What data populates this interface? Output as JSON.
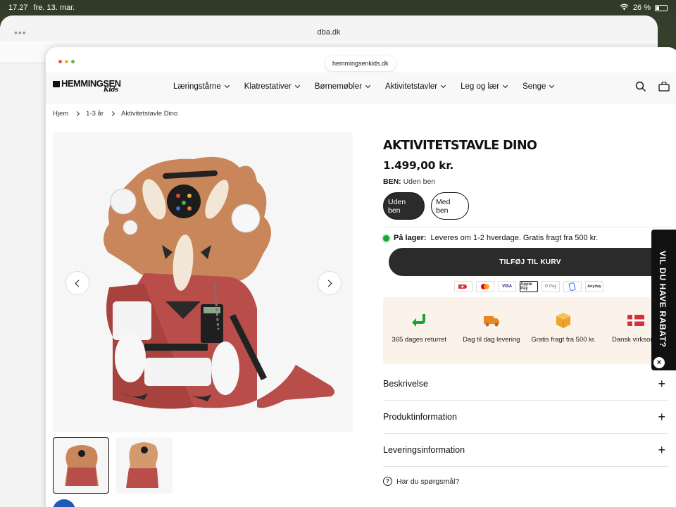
{
  "status": {
    "time": "17.27",
    "date": "fre. 13. mar.",
    "battery": "26 %"
  },
  "background_window": {
    "url": "dba.dk"
  },
  "browser": {
    "url": "hemmingsenkids.dk"
  },
  "logo": {
    "brand": "HEMMINGSEN",
    "sub": "Kids"
  },
  "nav": {
    "items": [
      {
        "label": "Læringstårne"
      },
      {
        "label": "Klatrestativer"
      },
      {
        "label": "Børnemøbler"
      },
      {
        "label": "Aktivitetstavler"
      },
      {
        "label": "Leg og lær"
      },
      {
        "label": "Senge"
      }
    ]
  },
  "breadcrumb": {
    "items": [
      "Hjem",
      "1-3 år",
      "Aktivitetstavle Dino"
    ]
  },
  "product": {
    "title": "AKTIVITETSTAVLE DINO",
    "price": "1.499,00 kr.",
    "variant_label": "BEN:",
    "variant_value": "Uden ben",
    "options": [
      {
        "label": "Uden ben",
        "selected": true
      },
      {
        "label": "Med ben",
        "selected": false
      }
    ],
    "stock_label": "På lager:",
    "stock_text": "Leveres om 1-2 hverdage. Gratis fragt fra 500 kr.",
    "add_to_cart": "TILFØJ TIL KURV"
  },
  "payments": [
    "Dankort",
    "Mastercard",
    "VISA",
    "Apple Pay",
    "G Pay",
    "MobilePay",
    "Anyday"
  ],
  "payment_icons": [
    "dankort-icon",
    "mastercard-icon",
    "visa-icon",
    "apple-pay-icon",
    "google-pay-icon",
    "mobilepay-icon",
    "anyday-icon"
  ],
  "perks": [
    {
      "text": "365 dages returret",
      "icon": "return-arrow-icon"
    },
    {
      "text": "Dag til dag levering",
      "icon": "truck-icon"
    },
    {
      "text": "Gratis fragt fra 500 kr.",
      "icon": "package-icon"
    },
    {
      "text": "Dansk virksomh",
      "icon": "danish-flag-icon"
    }
  ],
  "accordions": [
    "Beskrivelse",
    "Produktinformation",
    "Leveringsinformation"
  ],
  "question": "Har du spørgsmål?",
  "discount_tab": "VIL DU HAVE RABAT?",
  "colors": {
    "accent_dark": "#2b2b2b",
    "stock_green": "#1aa33b",
    "perk_bg": "#fbf3ea",
    "return_green": "#1aa33b",
    "truck_orange": "#e9862a",
    "package_orange": "#f0a32c",
    "flag_red": "#d6313a"
  }
}
